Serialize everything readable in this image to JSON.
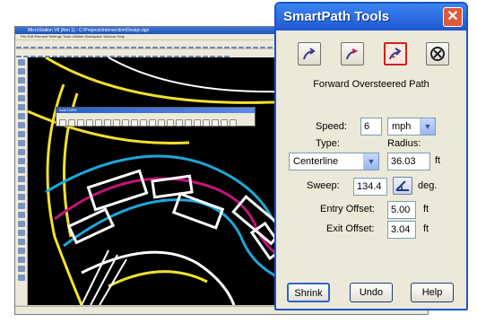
{
  "cad": {
    "title": "MicroStation V8 [Ann 1] - C:\\Projects\\Intersection\\Design.dgn",
    "menu": "File  Edit  Element  Settings  Tools  Utilities  Workspace  Window  Help",
    "tool_panel_title": "AutoTURN"
  },
  "dialog": {
    "title": "SmartPath Tools",
    "close_label": "✕",
    "tools": [
      {
        "icon": "forward-path-icon",
        "active": false
      },
      {
        "icon": "reverse-path-icon",
        "active": false
      },
      {
        "icon": "oversteered-path-icon",
        "active": true
      },
      {
        "icon": "cancel-path-icon",
        "active": false
      }
    ],
    "mode_label": "Forward Oversteered Path",
    "speed": {
      "label": "Speed:",
      "value": "6",
      "unit": "mph"
    },
    "type": {
      "label": "Type:",
      "value": "Centerline"
    },
    "radius": {
      "label": "Radius:",
      "value": "36.03",
      "unit": "ft"
    },
    "sweep": {
      "label": "Sweep:",
      "value": "134.4",
      "unit": "deg."
    },
    "entry_offset": {
      "label": "Entry Offset:",
      "value": "5.00",
      "unit": "ft"
    },
    "exit_offset": {
      "label": "Exit Offset:",
      "value": "3.04",
      "unit": "ft"
    },
    "buttons": {
      "shrink": "Shrink",
      "undo": "Undo",
      "help": "Help"
    }
  },
  "colors": {
    "titlebar": "#2a66e0",
    "dialog_bg": "#ece9d8",
    "canvas_bg": "#000000",
    "path_yellow": "#f2e12c",
    "path_cyan": "#1fa6d8",
    "path_magenta": "#c2147a"
  }
}
